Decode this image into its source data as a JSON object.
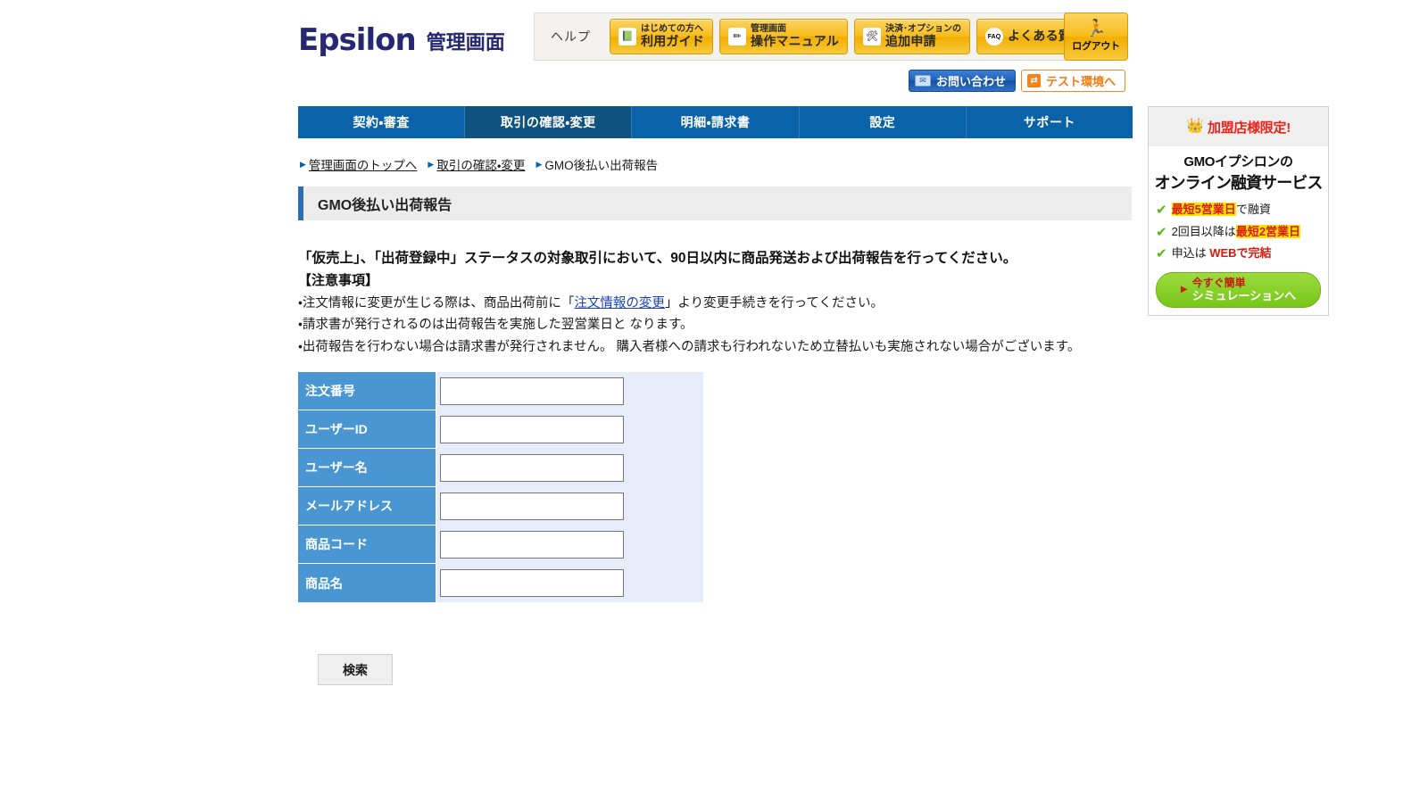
{
  "header": {
    "logo_mark": "Epsilon",
    "logo_sub": "管理画面",
    "help_label": "ヘルプ",
    "help_buttons": [
      {
        "icon": "book-icon",
        "glyph": "📗",
        "line1": "はじめての方へ",
        "line2": "利用ガイド"
      },
      {
        "icon": "pencil-icon",
        "glyph": "✏",
        "line1": "管理画面",
        "line2": "操作マニュアル"
      },
      {
        "icon": "tools-icon",
        "glyph": "🛠",
        "line1": "決済･オプションの",
        "line2": "追加申請"
      },
      {
        "icon": "faq-icon",
        "glyph": "FAQ",
        "line1": "",
        "line2": "よくある質問"
      }
    ],
    "logout": {
      "icon": "exit-door-icon",
      "glyph": "🏃",
      "label": "ログアウト"
    },
    "contact_button": {
      "icon": "mail-icon",
      "glyph": "✉",
      "label": "お問い合わせ"
    },
    "test_button": {
      "icon": "swap-icon",
      "glyph": "⇄",
      "label": "テスト環境へ"
    }
  },
  "nav": {
    "items": [
      {
        "label": "契約・審査",
        "active": false
      },
      {
        "label": "取引の確認・変更",
        "active": true
      },
      {
        "label": "明細・請求書",
        "active": false
      },
      {
        "label": "設定",
        "active": false
      },
      {
        "label": "サポート",
        "active": false
      }
    ]
  },
  "breadcrumb": {
    "items": [
      {
        "label": "管理画面のトップへ",
        "link": true
      },
      {
        "label": "取引の確認・変更",
        "link": true
      },
      {
        "label": "GMO後払い出荷報告",
        "link": false
      }
    ]
  },
  "page_title": "GMO後払い出荷報告",
  "notice": {
    "lead": "「仮売上」、「出荷登録中」ステータスの対象取引において、90日以内に商品発送および出荷報告を行ってください。",
    "caution_head": "【注意事項】",
    "bullet1_pre": "・注文情報に変更が生じる際は、商品出荷前に「",
    "bullet1_link": "注文情報の変更",
    "bullet1_post": "」より変更手続きを行ってください。",
    "bullet2": "・請求書が発行されるのは出荷報告を実施した翌営業日と なります。",
    "bullet3": "・出荷報告を行わない場合は請求書が発行されません。 購入者様への請求も行われないため立替払いも実施されない場合がございます。"
  },
  "search_form": {
    "fields": [
      {
        "label": "注文番号",
        "value": "",
        "placeholder": ""
      },
      {
        "label": "ユーザーID",
        "value": "",
        "placeholder": ""
      },
      {
        "label": "ユーザー名",
        "value": "",
        "placeholder": ""
      },
      {
        "label": "メールアドレス",
        "value": "",
        "placeholder": ""
      },
      {
        "label": "商品コード",
        "value": "",
        "placeholder": ""
      },
      {
        "label": "商品名",
        "value": "",
        "placeholder": ""
      }
    ],
    "submit_label": "検索"
  },
  "banner": {
    "crown_icon": "crown-icon",
    "crown_glyph": "👑",
    "top_title": "加盟店様限定!",
    "heading_line1": "GMOイプシロンの",
    "heading_line2": "オンライン融資サービス",
    "items": [
      {
        "pre": "",
        "hl": "最短5営業日",
        "post": "で融資"
      },
      {
        "pre": "2回目以降は",
        "hl": "最短2営業日",
        "post": ""
      },
      {
        "pre": "申込は ",
        "hl2": "WEBで完結",
        "post": ""
      }
    ],
    "cta_line1": "今すぐ簡単",
    "cta_line2": "シミュレーションへ"
  },
  "colors": {
    "nav_blue": "#0a63a8",
    "nav_active": "#10527f",
    "logo_navy": "#262873",
    "label_blue": "#4a96d2",
    "table_bg": "#e7ecfa",
    "accent_yellow": "#f7bd1e",
    "accent_orange": "#f5821f",
    "banner_red": "#e8241c",
    "cta_green": "#77c61b",
    "link_blue": "#1b3fbf"
  }
}
